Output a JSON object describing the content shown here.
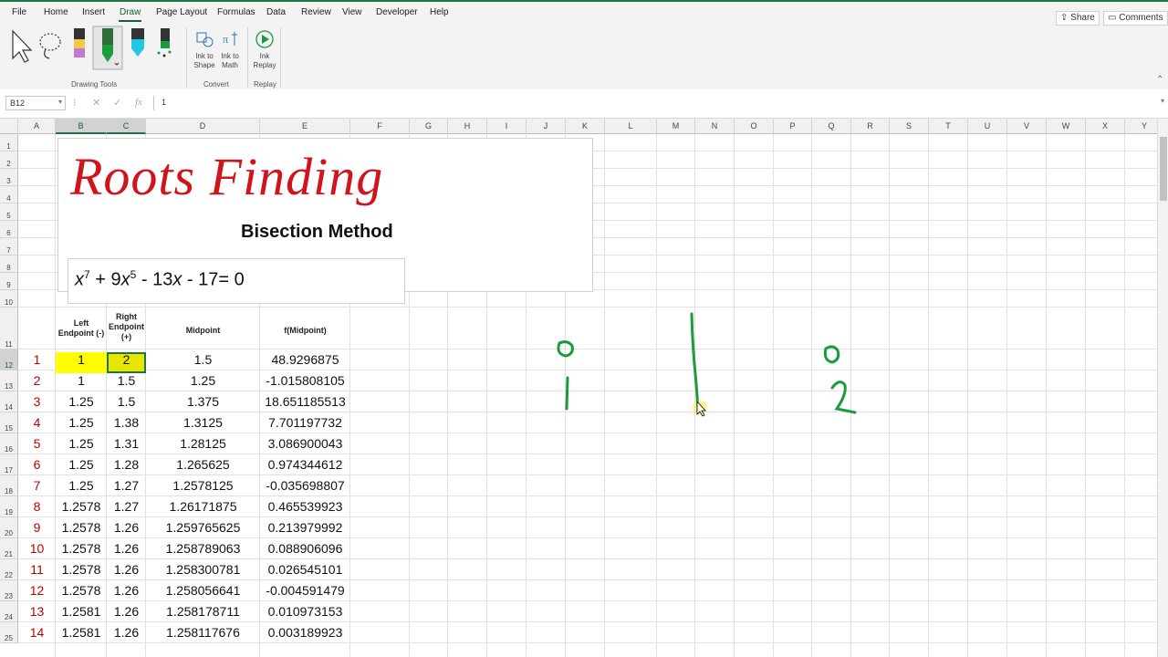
{
  "ribbon": {
    "tabs": [
      "File",
      "Home",
      "Insert",
      "Draw",
      "Page Layout",
      "Formulas",
      "Data",
      "Review",
      "View",
      "Developer",
      "Help"
    ],
    "active_tab": "Draw",
    "share_label": "Share",
    "comments_label": "Comments",
    "groups": {
      "drawing_tools": "Drawing Tools",
      "convert": "Convert",
      "replay": "Replay"
    },
    "buttons": {
      "ink_to_shape": "Ink to Shape",
      "ink_to_math": "Ink to Math",
      "ink_replay": "Ink Replay"
    }
  },
  "formula_bar": {
    "name_box": "B12",
    "formula": "1"
  },
  "sheet": {
    "columns": [
      "A",
      "B",
      "C",
      "D",
      "E",
      "F",
      "G",
      "H",
      "I",
      "J",
      "K",
      "L",
      "M",
      "N",
      "O",
      "P",
      "Q",
      "R",
      "S",
      "T",
      "U",
      "V",
      "W",
      "X",
      "Y"
    ],
    "selected_columns": [
      "B",
      "C"
    ],
    "rows": [
      "1",
      "2",
      "3",
      "4",
      "5",
      "6",
      "7",
      "8",
      "9",
      "10",
      "11",
      "12",
      "13",
      "14",
      "15",
      "16",
      "17",
      "18",
      "19",
      "20",
      "21",
      "22",
      "23",
      "24",
      "25"
    ],
    "selected_row": "12",
    "title": "Roots Finding",
    "subtitle": "Bisection Method",
    "equation": {
      "t1": "x",
      "e1": "7",
      "t2": " + 9",
      "t3": "x",
      "e2": "5",
      "t4": " - 13",
      "t5": "x",
      "t6": " - 17= 0"
    },
    "headers": {
      "left": "Left Endpoint (-)",
      "right": "Right Endpoint (+)",
      "mid": "Midpoint",
      "fmid": "f(Midpoint)"
    },
    "table": [
      {
        "i": "1",
        "left": "1",
        "right": "2",
        "mid": "1.5",
        "fmid": "48.9296875"
      },
      {
        "i": "2",
        "left": "1",
        "right": "1.5",
        "mid": "1.25",
        "fmid": "-1.015808105"
      },
      {
        "i": "3",
        "left": "1.25",
        "right": "1.5",
        "mid": "1.375",
        "fmid": "18.651185513"
      },
      {
        "i": "4",
        "left": "1.25",
        "right": "1.38",
        "mid": "1.3125",
        "fmid": "7.701197732"
      },
      {
        "i": "5",
        "left": "1.25",
        "right": "1.31",
        "mid": "1.28125",
        "fmid": "3.086900043"
      },
      {
        "i": "6",
        "left": "1.25",
        "right": "1.28",
        "mid": "1.265625",
        "fmid": "0.974344612"
      },
      {
        "i": "7",
        "left": "1.25",
        "right": "1.27",
        "mid": "1.2578125",
        "fmid": "-0.035698807"
      },
      {
        "i": "8",
        "left": "1.2578",
        "right": "1.27",
        "mid": "1.26171875",
        "fmid": "0.465539923"
      },
      {
        "i": "9",
        "left": "1.2578",
        "right": "1.26",
        "mid": "1.259765625",
        "fmid": "0.213979992"
      },
      {
        "i": "10",
        "left": "1.2578",
        "right": "1.26",
        "mid": "1.258789063",
        "fmid": "0.088906096"
      },
      {
        "i": "11",
        "left": "1.2578",
        "right": "1.26",
        "mid": "1.258300781",
        "fmid": "0.026545101"
      },
      {
        "i": "12",
        "left": "1.2578",
        "right": "1.26",
        "mid": "1.258056641",
        "fmid": "-0.004591479"
      },
      {
        "i": "13",
        "left": "1.2581",
        "right": "1.26",
        "mid": "1.258178711",
        "fmid": "0.010973153"
      },
      {
        "i": "14",
        "left": "1.2581",
        "right": "1.26",
        "mid": "1.258117676",
        "fmid": "0.003189923"
      }
    ]
  },
  "colors": {
    "accent": "#217346",
    "title_red": "#d0141b",
    "highlight_yellow": "#ffff00",
    "ink_green": "#1a9c3e"
  }
}
